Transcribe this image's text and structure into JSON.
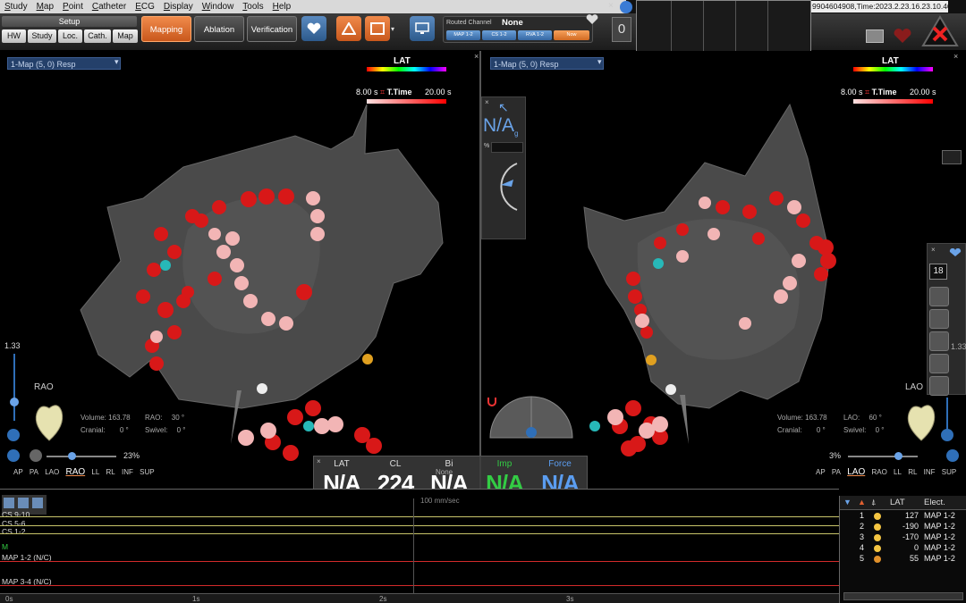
{
  "menu": [
    "Study",
    "Map",
    "Point",
    "Catheter",
    "ECG",
    "Display",
    "Window",
    "Tools",
    "Help"
  ],
  "session_info": "9904604908,Time:2023.2.23.16.23.10.460",
  "toolbar": {
    "setup_label": "Setup",
    "setup_buttons": [
      "HW",
      "Study",
      "Loc.",
      "Cath.",
      "Map"
    ],
    "modes": [
      {
        "label": "Mapping",
        "active": true
      },
      {
        "label": "Ablation",
        "active": false
      },
      {
        "label": "Verification",
        "active": false
      }
    ],
    "routed_channel_label": "Routed Channel",
    "routed_channel_value": "None",
    "channel_chips": [
      "MAP 1-2",
      "CS 1-2",
      "RVA 1-2",
      "Now"
    ],
    "counter": "0"
  },
  "left_view": {
    "map_selector": "1-Map (5, 0) Resp",
    "lat_label": "LAT",
    "ttime_min": "8.00 s",
    "ttime_label": "T.Time",
    "ttime_max": "20.00 s",
    "zoom_value": "1.33",
    "orientation": "RAO",
    "volume_label": "Volume:",
    "volume_value": "163.78",
    "angle1_label": "RAO:",
    "angle1_value": "30 °",
    "cranial_label": "Cranial:",
    "cranial_value": "0 °",
    "swivel_label": "Swivel:",
    "swivel_value": "0 °",
    "opacity": "23%",
    "view_buttons": [
      "AP",
      "PA",
      "LAO",
      "RAO",
      "LL",
      "RL",
      "INF",
      "SUP"
    ],
    "selected_view": "RAO"
  },
  "right_view": {
    "map_selector": "1-Map (5, 0) Resp",
    "lat_label": "LAT",
    "ttime_min": "8.00 s",
    "ttime_label": "T.Time",
    "ttime_max": "20.00 s",
    "zoom_value": "1.33",
    "orientation": "LAO",
    "volume_label": "Volume:",
    "volume_value": "163.78",
    "angle1_label": "LAO:",
    "angle1_value": "60 °",
    "cranial_label": "Cranial:",
    "cranial_value": "0 °",
    "swivel_label": "Swivel:",
    "swivel_value": "0 °",
    "opacity": "3%",
    "view_buttons": [
      "AP",
      "PA",
      "LAO",
      "RAO",
      "LL",
      "RL",
      "INF",
      "SUP"
    ],
    "selected_view": "LAO",
    "side_counter": "18"
  },
  "center_panel": {
    "value": "N/A",
    "subscript": "g",
    "percent": "%"
  },
  "values_panel": {
    "items": [
      {
        "label": "LAT",
        "value": "N/A",
        "color": "#ffffff",
        "label_color": "#dddddd"
      },
      {
        "label": "CL",
        "value": "224",
        "color": "#ffffff",
        "label_color": "#dddddd"
      },
      {
        "label": "Bi",
        "value": "N/A",
        "color": "#ffffff",
        "label_color": "#dddddd"
      },
      {
        "label": "Imp",
        "value": "N/A",
        "color": "#33cc44",
        "label_color": "#33cc44"
      },
      {
        "label": "Force",
        "value": "N/A",
        "color": "#5b9df0",
        "label_color": "#5b9df0"
      }
    ],
    "bi_dropdown": "None",
    "scale_note": "100 mm/sec"
  },
  "traces": {
    "channels": [
      {
        "label": "CS 9-10",
        "color": "#c9c56a"
      },
      {
        "label": "CS 5-6",
        "color": "#c9c56a"
      },
      {
        "label": "CS 1-2",
        "color": "#c9c56a"
      },
      {
        "label": "M",
        "color": "#33cc44"
      },
      {
        "label": "MAP 1-2 (N/C)",
        "color": "#d22a2a"
      },
      {
        "label": "MAP 3-4 (N/C)",
        "color": "#d22a2a"
      }
    ],
    "time_ticks": [
      "0s",
      "1s",
      "2s",
      "3s"
    ]
  },
  "point_table": {
    "headers": [
      "LAT",
      "Elect."
    ],
    "rows": [
      {
        "id": "1",
        "lat": "127",
        "elect": "MAP 1-2"
      },
      {
        "id": "2",
        "lat": "-190",
        "elect": "MAP 1-2"
      },
      {
        "id": "3",
        "lat": "-170",
        "elect": "MAP 1-2"
      },
      {
        "id": "4",
        "lat": "0",
        "elect": "MAP 1-2"
      },
      {
        "id": "5",
        "lat": "55",
        "elect": "MAP 1-2"
      }
    ]
  }
}
